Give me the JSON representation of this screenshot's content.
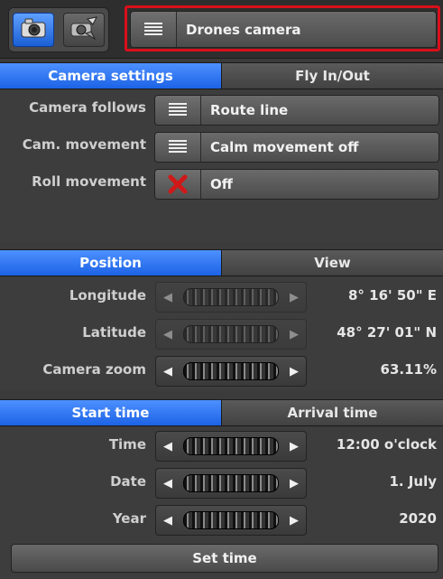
{
  "header": {
    "mode_buttons": [
      {
        "icon": "camera-icon",
        "active": true
      },
      {
        "icon": "drone-camera-icon",
        "active": false
      }
    ],
    "dropdown_label": "Drones camera",
    "dropdown_icon": "hamburger-menu-icon"
  },
  "camera_tabs": [
    {
      "label": "Camera settings",
      "active": true
    },
    {
      "label": "Fly In/Out",
      "active": false
    }
  ],
  "camera_settings": [
    {
      "label": "Camera follows",
      "value": "Route line",
      "icon": "hamburger-menu-icon"
    },
    {
      "label": "Cam. movement",
      "value": "Calm movement off",
      "icon": "hamburger-menu-icon"
    },
    {
      "label": "Roll movement",
      "value": "Off",
      "icon": "red-x-icon"
    }
  ],
  "position_tabs": [
    {
      "label": "Position",
      "active": true
    },
    {
      "label": "View",
      "active": false
    }
  ],
  "position_rows": [
    {
      "label": "Longitude",
      "value": "8° 16' 50\" E",
      "enabled": false
    },
    {
      "label": "Latitude",
      "value": "48° 27' 01\" N",
      "enabled": false
    },
    {
      "label": "Camera zoom",
      "value": "63.11%",
      "enabled": true
    }
  ],
  "time_tabs": [
    {
      "label": "Start time",
      "active": true
    },
    {
      "label": "Arrival time",
      "active": false
    }
  ],
  "time_rows": [
    {
      "label": "Time",
      "value": "12:00 o'clock",
      "enabled": true
    },
    {
      "label": "Date",
      "value": "1. July",
      "enabled": true
    },
    {
      "label": "Year",
      "value": "2020",
      "enabled": true
    }
  ],
  "set_time_label": "Set time",
  "colors": {
    "accent_blue": "#1c63e6",
    "highlight_red": "#d8101a",
    "background": "#3b3b3b"
  }
}
